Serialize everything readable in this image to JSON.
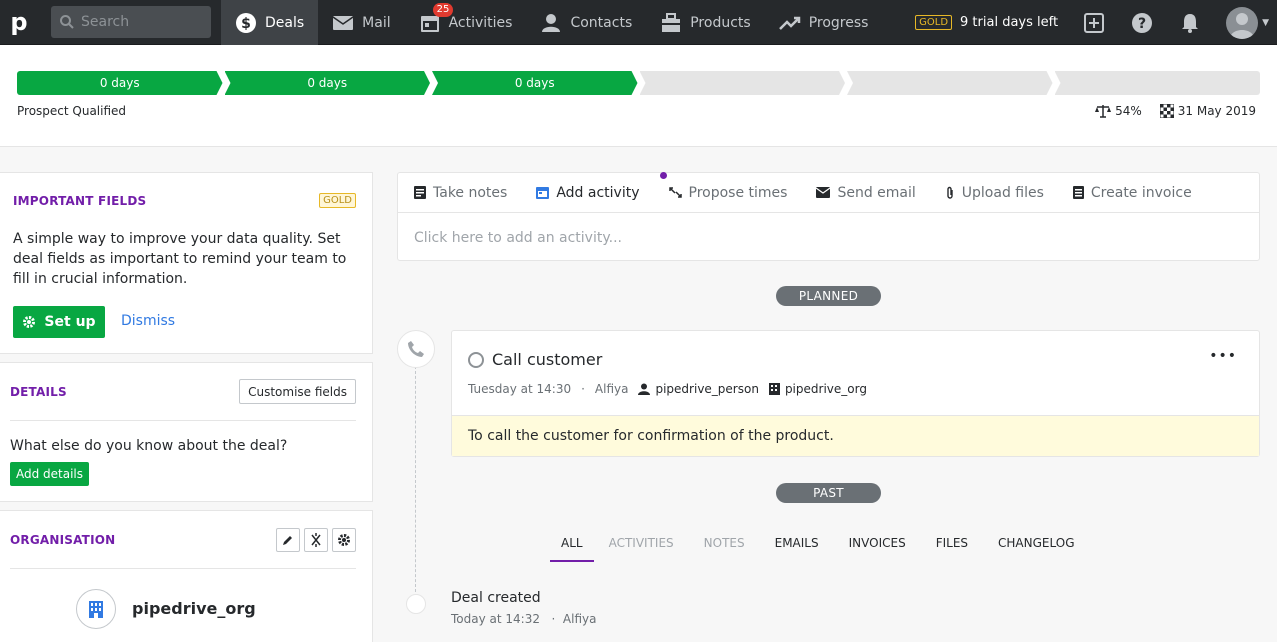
{
  "nav": {
    "search_placeholder": "Search",
    "items": [
      {
        "label": "Deals",
        "icon": "dollar-icon"
      },
      {
        "label": "Mail",
        "icon": "envelope-icon"
      },
      {
        "label": "Activities",
        "icon": "calendar-icon",
        "badge": "25"
      },
      {
        "label": "Contacts",
        "icon": "person-icon"
      },
      {
        "label": "Products",
        "icon": "box-icon"
      },
      {
        "label": "Progress",
        "icon": "trend-icon"
      }
    ],
    "gold": "GOLD",
    "trial": "9 trial days left"
  },
  "pipeline": {
    "stages": [
      "0 days",
      "0 days",
      "0 days",
      "",
      "",
      ""
    ],
    "completed_stages": 3,
    "current_stage": "Prospect Qualified",
    "probability": "54%",
    "close_date": "31 May 2019"
  },
  "important": {
    "title": "IMPORTANT FIELDS",
    "badge": "GOLD",
    "text": "A simple way to improve your data quality. Set deal fields as important to remind your team to fill in crucial information.",
    "setup": "Set up",
    "dismiss": "Dismiss"
  },
  "details": {
    "title": "DETAILS",
    "customise": "Customise fields",
    "question": "What else do you know about the deal?",
    "add": "Add details"
  },
  "organisation": {
    "title": "ORGANISATION",
    "name": "pipedrive_org"
  },
  "composer": {
    "tabs": [
      "Take notes",
      "Add activity",
      "Propose times",
      "Send email",
      "Upload files",
      "Create invoice"
    ],
    "placeholder": "Click here to add an activity..."
  },
  "timeline": {
    "planned": "PLANNED",
    "past": "PAST",
    "activity": {
      "title": "Call customer",
      "when": "Tuesday at 14:30",
      "owner": "Alfiya",
      "person": "pipedrive_person",
      "org": "pipedrive_org",
      "note": "To call the customer for confirmation of the product."
    },
    "filters": [
      "ALL",
      "ACTIVITIES",
      "NOTES",
      "EMAILS",
      "INVOICES",
      "FILES",
      "CHANGELOG"
    ],
    "created": {
      "title": "Deal created",
      "when": "Today at 14:32",
      "owner": "Alfiya"
    }
  },
  "colors": {
    "accent_green": "#08a742",
    "purple": "#721ea9",
    "link_blue": "#317ae2",
    "nav_bg": "#26292c"
  }
}
